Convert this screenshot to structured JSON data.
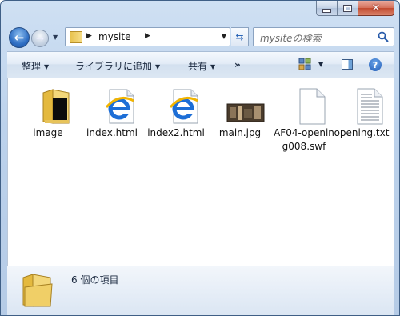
{
  "window": {
    "caption_buttons": [
      "minimize",
      "maximize",
      "close"
    ]
  },
  "nav": {
    "address": {
      "crumbs": [
        "mysite"
      ]
    },
    "search": {
      "placeholder": "mysiteの検索"
    }
  },
  "commands": {
    "organize": "整理",
    "add_to_library": "ライブラリに追加",
    "share": "共有",
    "more": "»"
  },
  "files": [
    {
      "name": "image",
      "icon": "folder-icon"
    },
    {
      "name": "index.html",
      "icon": "ie-html-icon"
    },
    {
      "name": "index2.html",
      "icon": "ie-html-icon"
    },
    {
      "name": "main.jpg",
      "icon": "jpg-thumbnail"
    },
    {
      "name": "AF04-opening008.swf",
      "icon": "blank-file-icon"
    },
    {
      "name": "opening.txt",
      "icon": "text-file-icon"
    }
  ],
  "details": {
    "count_text": "6 個の項目"
  },
  "colors": {
    "accent": "#2f6fc4",
    "folder": "#e8c24e"
  }
}
